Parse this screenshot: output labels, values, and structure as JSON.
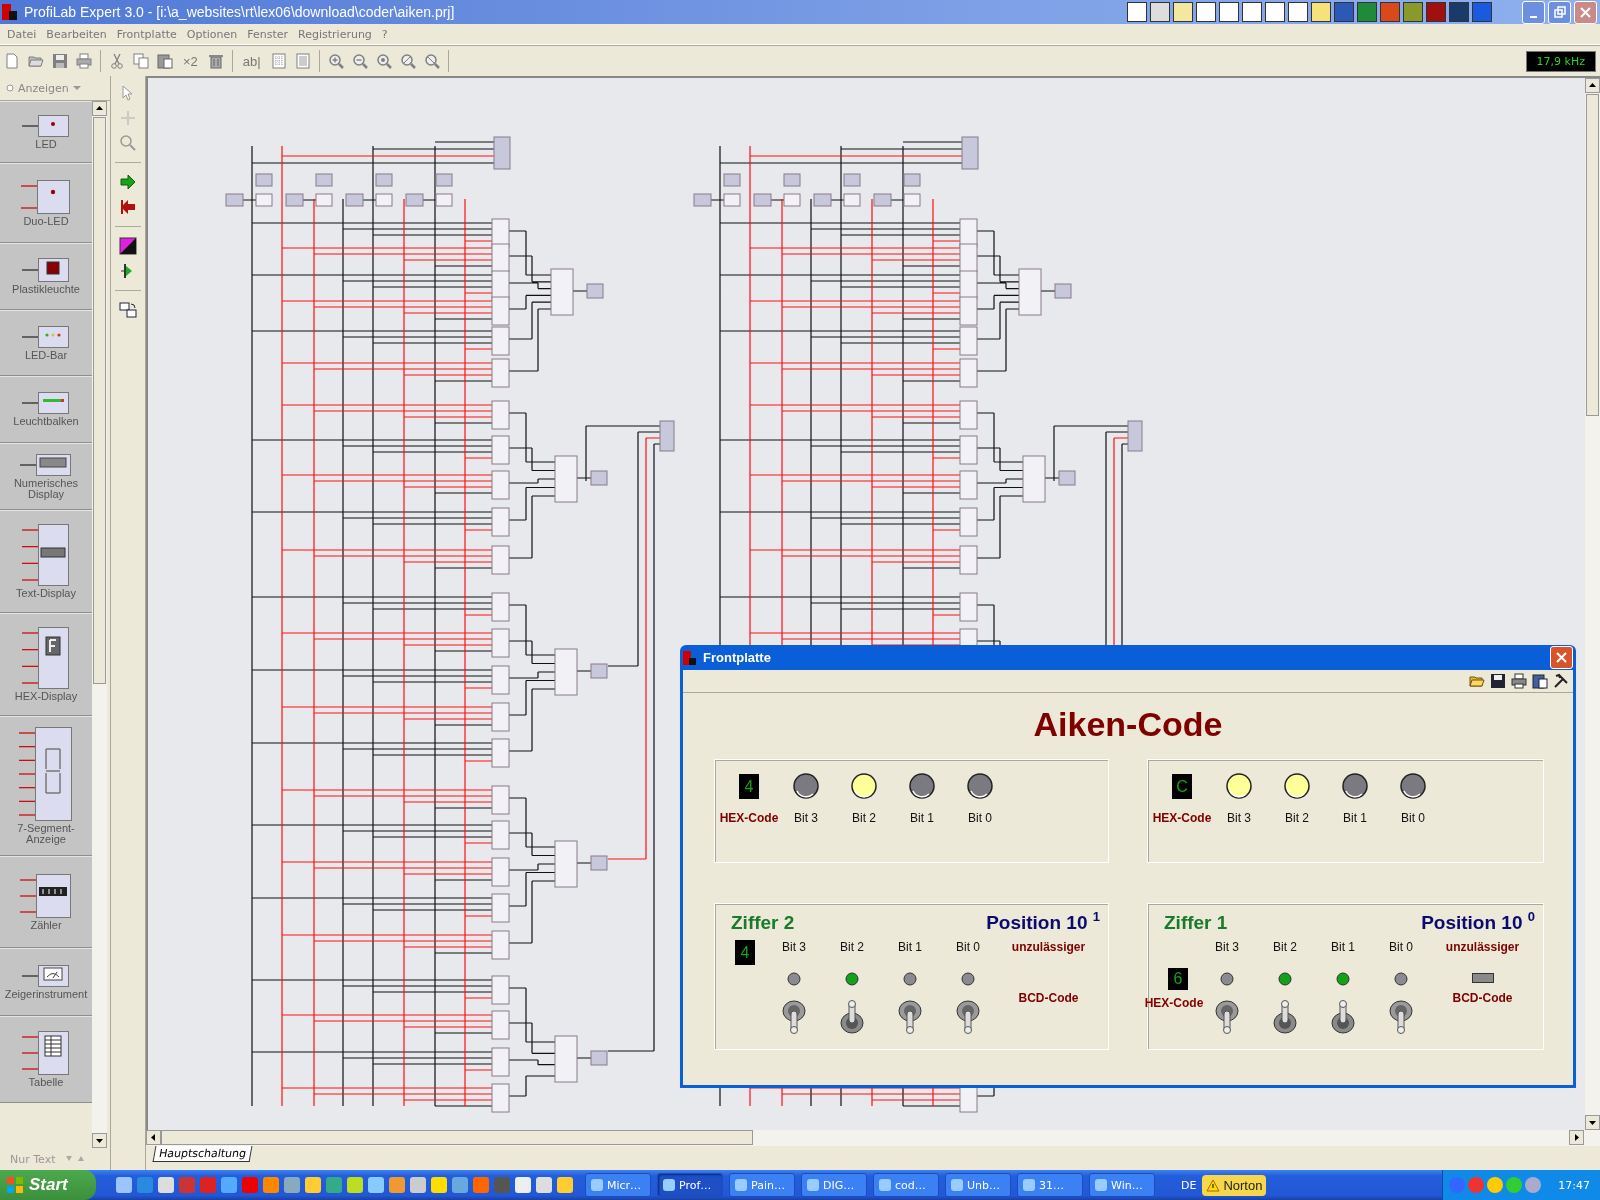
{
  "window": {
    "title": "ProfiLab Expert 3.0 - [i:\\a_websites\\rt\\lex06\\download\\coder\\aiken.prj]"
  },
  "menu": [
    {
      "label": "Datei"
    },
    {
      "label": "Bearbeiten"
    },
    {
      "label": "Frontplatte"
    },
    {
      "label": "Optionen"
    },
    {
      "label": "Fenster"
    },
    {
      "label": "Registrierung"
    },
    {
      "label": "?"
    }
  ],
  "toolbar": {
    "groups": [
      [
        {
          "kind": "new"
        },
        {
          "kind": "open"
        },
        {
          "kind": "save"
        },
        {
          "kind": "print"
        }
      ],
      [
        {
          "kind": "cut"
        },
        {
          "kind": "copy"
        },
        {
          "kind": "paste"
        },
        {
          "kind": "text",
          "label": "×2"
        },
        {
          "kind": "delete"
        }
      ],
      [
        {
          "kind": "text",
          "label": "ab|"
        },
        {
          "kind": "grid"
        },
        {
          "kind": "page"
        }
      ],
      [
        {
          "kind": "zoom-in"
        },
        {
          "kind": "zoom-out"
        },
        {
          "kind": "zoom"
        },
        {
          "kind": "zoom-area"
        },
        {
          "kind": "zoom-all"
        }
      ]
    ],
    "frequency": "17,9 kHz"
  },
  "palette": {
    "category": "Anzeigen",
    "items": [
      {
        "kind": "led",
        "label": "LED"
      },
      {
        "kind": "duoled",
        "label": "Duo-LED"
      },
      {
        "kind": "lamp",
        "label": "Plastikleuchte"
      },
      {
        "kind": "ledbar",
        "label": "LED-Bar"
      },
      {
        "kind": "bar",
        "label": "Leuchtbalken"
      },
      {
        "kind": "numeric",
        "label": "Numerisches Display"
      },
      {
        "kind": "text",
        "label": "Text-Display"
      },
      {
        "kind": "hex",
        "label": "HEX-Display"
      },
      {
        "kind": "seg7",
        "label": "7-Segment-Anzeige"
      },
      {
        "kind": "counter",
        "label": "Zähler"
      },
      {
        "kind": "meter",
        "label": "Zeigerinstrument"
      },
      {
        "kind": "table",
        "label": "Tabelle"
      }
    ],
    "footer": "Nur Text"
  },
  "sheet_tabs": [
    {
      "label": "Hauptschaltung",
      "selected": true
    }
  ],
  "frontplatte": {
    "title": "Frontplatte",
    "heading": "Aiken-Code",
    "displays": [
      {
        "hex": "4",
        "hex_label": "HEX-Code",
        "leds": [
          {
            "label": "Bit 3",
            "on": false
          },
          {
            "label": "Bit 2",
            "on": true
          },
          {
            "label": "Bit 1",
            "on": false
          },
          {
            "label": "Bit 0",
            "on": false
          }
        ]
      },
      {
        "hex": "C",
        "hex_label": "HEX-Code",
        "leds": [
          {
            "label": "Bit 3",
            "on": true
          },
          {
            "label": "Bit 2",
            "on": true
          },
          {
            "label": "Bit 1",
            "on": false
          },
          {
            "label": "Bit 0",
            "on": false
          }
        ]
      }
    ],
    "digits": [
      {
        "title": "Ziffer 2",
        "position": "Position 10 $^{1}$",
        "hex": "4",
        "bits": [
          {
            "label": "Bit 3",
            "on": false
          },
          {
            "label": "Bit 2",
            "on": true
          },
          {
            "label": "Bit 1",
            "on": false
          },
          {
            "label": "Bit 0",
            "on": false
          }
        ],
        "error_text": [
          "unzulässiger",
          "BCD-Code"
        ]
      },
      {
        "title": "Ziffer 1",
        "position": "Position 10 $^{0}$",
        "hex": "6",
        "hex_label": "HEX-Code",
        "bits": [
          {
            "label": "Bit 3",
            "on": false
          },
          {
            "label": "Bit 2",
            "on": true
          },
          {
            "label": "Bit 1",
            "on": true
          },
          {
            "label": "Bit 0",
            "on": false
          }
        ],
        "error_lamp_on": false,
        "error_text": [
          "unzulässiger",
          "BCD-Code"
        ]
      }
    ]
  },
  "taskbar": {
    "start": "Start",
    "tasks": [
      {
        "label": "Micr…",
        "selected": false
      },
      {
        "label": "Prof…",
        "selected": true
      },
      {
        "label": "Pain…",
        "selected": false
      },
      {
        "label": "DIG…",
        "selected": false
      },
      {
        "label": "cod…",
        "selected": false
      },
      {
        "label": "Unb…",
        "selected": false
      },
      {
        "label": "31…",
        "selected": false
      },
      {
        "label": "Win…",
        "selected": false
      }
    ],
    "language": "DE",
    "antivirus": "Norton",
    "clock": "17:47"
  }
}
